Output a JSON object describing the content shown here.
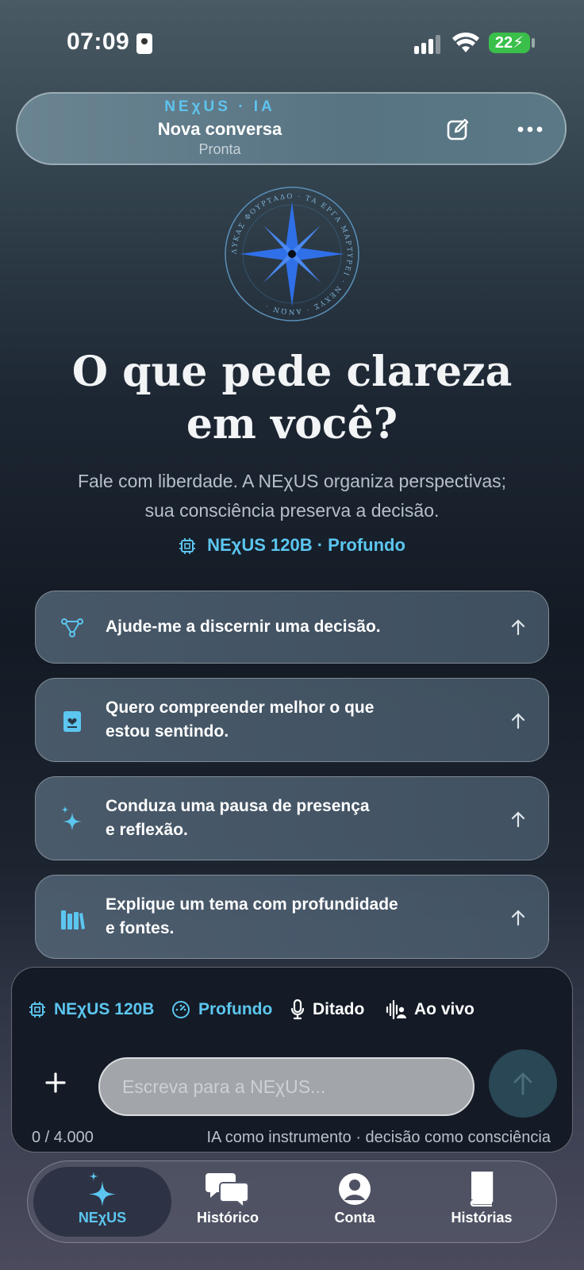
{
  "status_bar": {
    "time": "07:09",
    "battery": "22"
  },
  "header": {
    "brand": "NEχUS · IA",
    "title": "Nova conversa",
    "status": "Pronta"
  },
  "emblem": {
    "ring_text": "ΛΥΚΑΣ ΦΟΥΡΤΑΔΟ · ΤΑ ΕΡΓΑ ΜΑΡΤΥΡΕΙ · ΝΕΧΥΣ · ΑΝΩΝ ·"
  },
  "hero": {
    "title_line1": "O que pede clareza",
    "title_line2": "em você?",
    "subtitle_line1": "Fale com liberdade. A NEχUS organiza perspectivas;",
    "subtitle_line2": "sua consciência preserva a decisão.",
    "model": "NEχUS 120B · Profundo"
  },
  "suggestions": [
    {
      "icon": "branch-icon",
      "line1": "Ajude-me a discernir uma decisão.",
      "line2": ""
    },
    {
      "icon": "journal-heart-icon",
      "line1": "Quero compreender melhor o que",
      "line2": "estou sentindo."
    },
    {
      "icon": "sparkles-icon",
      "line1": "Conduza uma pausa de presença",
      "line2": "e reflexão."
    },
    {
      "icon": "books-icon",
      "line1": "Explique um tema com profundidade",
      "line2": "e fontes."
    }
  ],
  "composer": {
    "model": "NEχUS 120B",
    "mode": "Profundo",
    "dictate": "Ditado",
    "live": "Ao vivo",
    "placeholder": "Escreva para a NEχUS...",
    "counter": "0 / 4.000",
    "tagline": "IA como instrumento · decisão como consciência"
  },
  "nav": [
    {
      "label": "NEχUS",
      "active": true
    },
    {
      "label": "Histórico",
      "active": false
    },
    {
      "label": "Conta",
      "active": false
    },
    {
      "label": "Histórias",
      "active": false
    }
  ],
  "colors": {
    "accent": "#5cc6f0",
    "emblem_blue": "#2f6fe8"
  }
}
